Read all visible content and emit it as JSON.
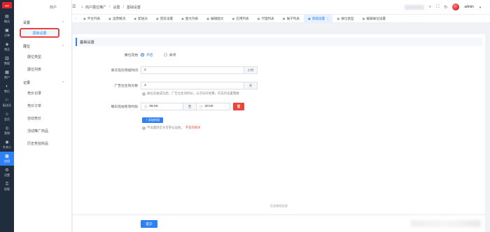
{
  "rail": {
    "items": [
      {
        "icon": "▤",
        "label": "概况"
      },
      {
        "icon": "▣",
        "label": "订单"
      },
      {
        "icon": "◈",
        "label": "商品"
      },
      {
        "icon": "▥",
        "label": "数据"
      },
      {
        "icon": "▦",
        "label": "商户"
      },
      {
        "icon": "◐",
        "label": "售后"
      },
      {
        "icon": "⚐",
        "label": "配送员"
      },
      {
        "icon": "☺",
        "label": "会员"
      },
      {
        "icon": "◎",
        "label": "营销"
      },
      {
        "icon": "◉",
        "label": "外卖小"
      },
      {
        "icon": "▩",
        "label": "应用"
      },
      {
        "icon": "⚙",
        "label": "设置"
      },
      {
        "icon": "⚿",
        "label": "权限"
      }
    ],
    "active_index": 10
  },
  "subnav": {
    "title": "商户",
    "groups": [
      {
        "label": "设置",
        "items": [
          "基础设置"
        ]
      },
      {
        "label": "展位",
        "items": [
          "展位类型",
          "展位列表"
        ]
      },
      {
        "label": "记录",
        "items": [
          "竞价记录",
          "竞价订单",
          "自动竞价",
          "活动推广商品",
          "历史竞拍商品"
        ]
      }
    ],
    "active_item": "基础设置"
  },
  "breadcrumb": {
    "items": [
      "商户展位推广",
      "设置",
      "基础设置"
    ]
  },
  "topbar": {
    "user": "admin"
  },
  "tabs": {
    "items": [
      {
        "label": "平台列表",
        "active": false
      },
      {
        "label": "运营概况",
        "active": false
      },
      {
        "label": "配送员",
        "active": false
      },
      {
        "label": "回答设置",
        "active": false
      },
      {
        "label": "图文列表",
        "active": false
      },
      {
        "label": "编辑图文",
        "active": false
      },
      {
        "label": "应用列表",
        "active": false
      },
      {
        "label": "代理列表",
        "active": false
      },
      {
        "label": "展子列表",
        "active": false
      },
      {
        "label": "基础设置",
        "active": true
      },
      {
        "label": "展位类型",
        "active": false
      },
      {
        "label": "编辑展位设置",
        "active": false
      }
    ]
  },
  "form": {
    "section_title": "基础设置",
    "bidding": {
      "label": "展位竞拍",
      "options": [
        "开启",
        "关闭"
      ],
      "selected": "开启"
    },
    "single_duration": {
      "label": "单次竞价持续时间",
      "value": "2",
      "unit": "小时"
    },
    "ad_days": {
      "label": "广告位生效天数",
      "value": "3",
      "unit": "天",
      "hint": "展位竞拍成功后，广告位生效时长，从次日开始算，仅支持设置整数"
    },
    "daily_time": {
      "label": "每日竞拍有效时段",
      "start": "06:00",
      "to": "至",
      "end": "20:00",
      "delete_label": "删除"
    },
    "add_button": "+ 添加时段",
    "time_hint_prefix": "不设置则全天可参与竞拍，",
    "time_hint_red": "不支持跨天"
  },
  "footer": {
    "text": "后台版权信息",
    "save_label": "提交"
  }
}
